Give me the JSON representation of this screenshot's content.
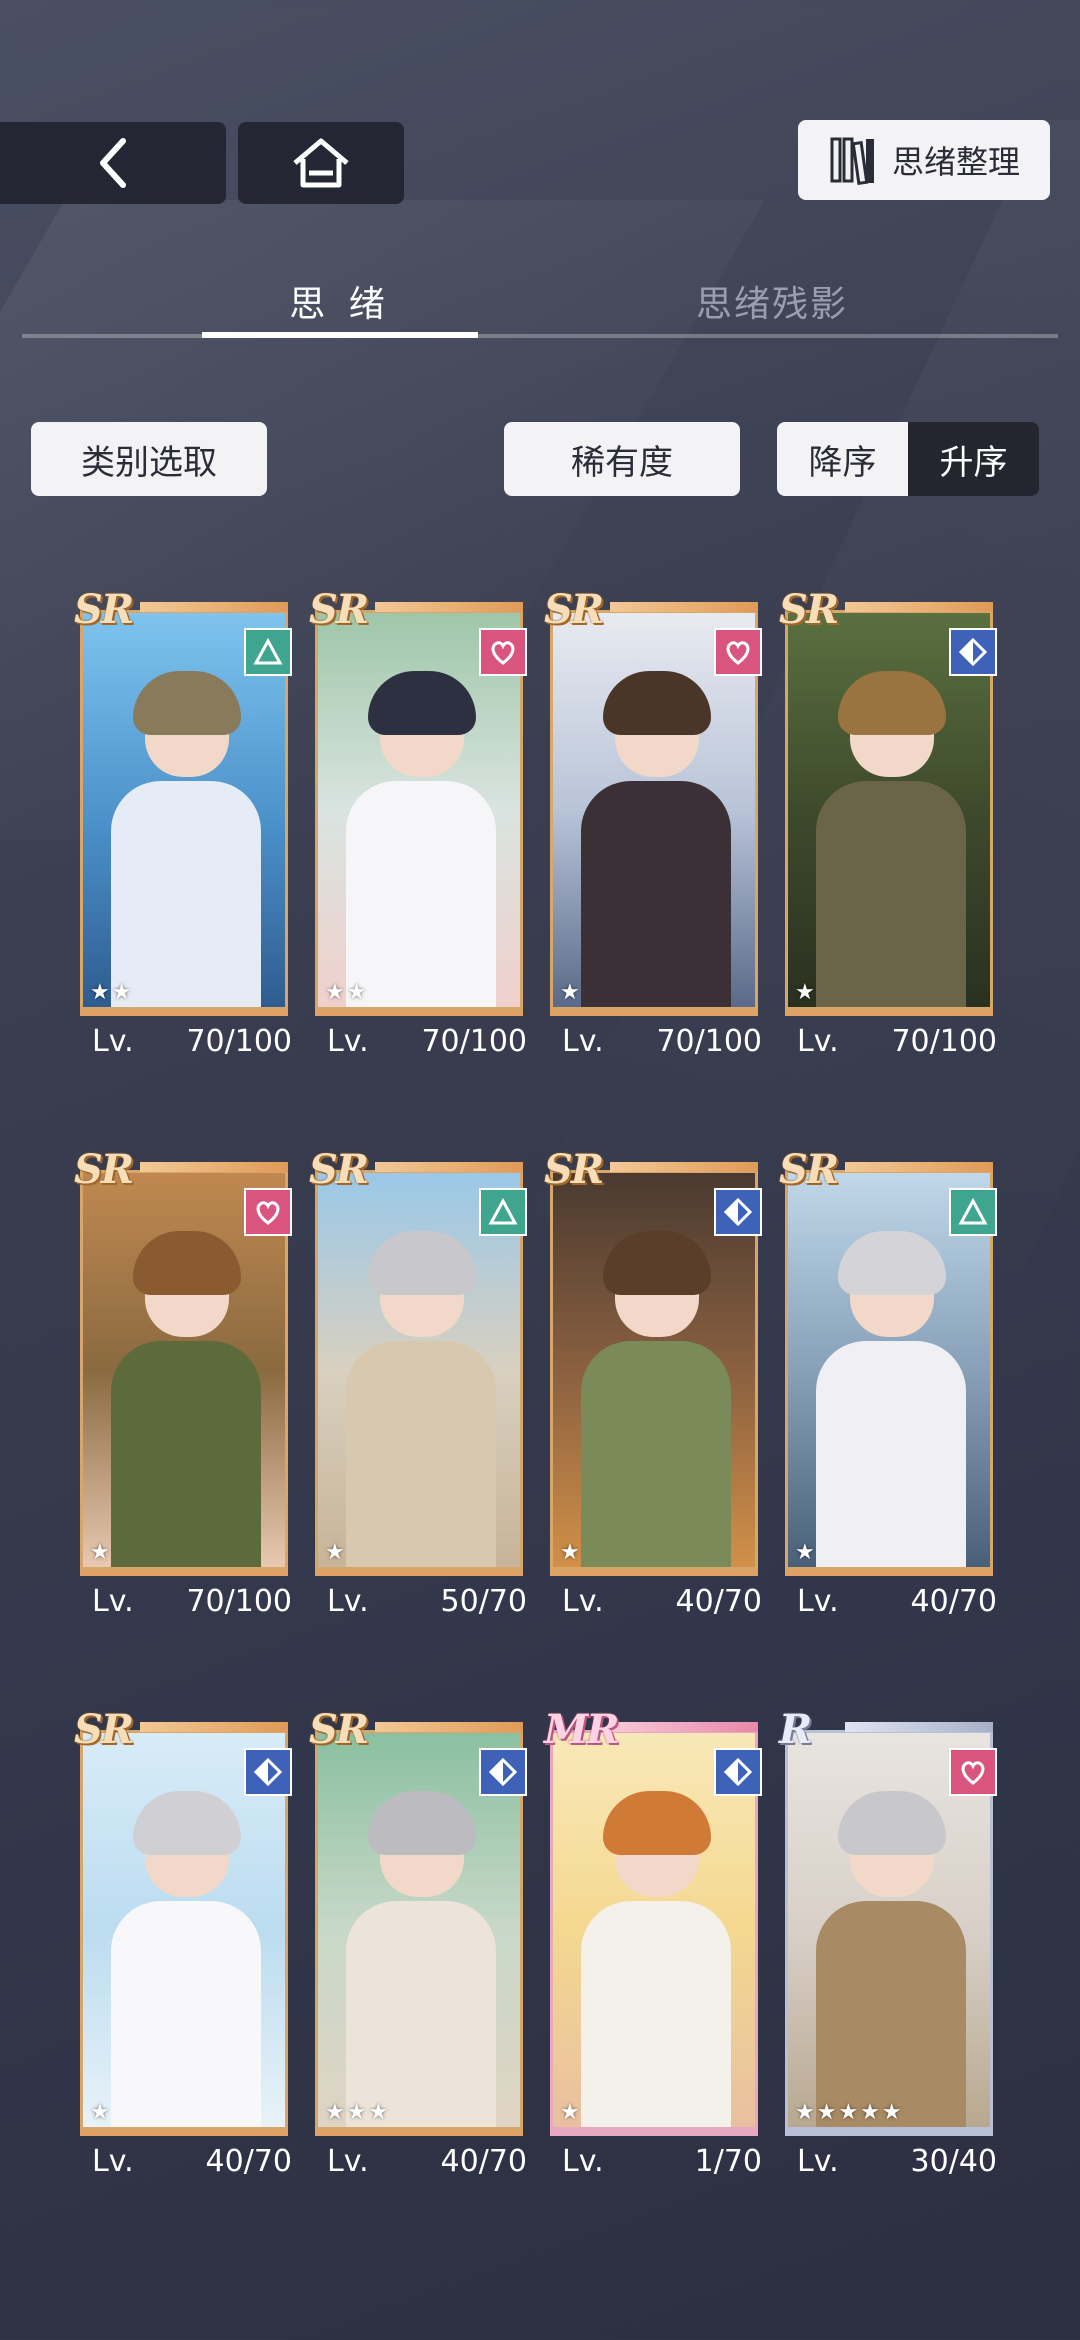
{
  "header": {
    "organize_label": "思绪整理"
  },
  "tabs": [
    {
      "label": "思 绪",
      "active": true
    },
    {
      "label": "思绪残影",
      "active": false
    }
  ],
  "filters": {
    "category_label": "类别选取",
    "rarity_label": "稀有度",
    "sort_desc_label": "降序",
    "sort_asc_label": "升序",
    "sort_selected": "升序"
  },
  "colors": {
    "attr_green": "#3fa58e",
    "attr_pink": "#d9547e",
    "attr_blue": "#3d62b8",
    "sr_frame": "#d9a66a",
    "mr_frame": "#e8a8c0",
    "r_frame": "#b8c0d8"
  },
  "cards": [
    {
      "rarity": "SR",
      "attribute": "triangle-icon",
      "stars": "★★",
      "lv_label": "Lv.",
      "level": "70/100"
    },
    {
      "rarity": "SR",
      "attribute": "heart-icon",
      "stars": "★★",
      "lv_label": "Lv.",
      "level": "70/100"
    },
    {
      "rarity": "SR",
      "attribute": "heart-icon",
      "stars": "★",
      "lv_label": "Lv.",
      "level": "70/100"
    },
    {
      "rarity": "SR",
      "attribute": "diamond-icon",
      "stars": "★",
      "lv_label": "Lv.",
      "level": "70/100"
    },
    {
      "rarity": "SR",
      "attribute": "heart-icon",
      "stars": "★",
      "lv_label": "Lv.",
      "level": "70/100"
    },
    {
      "rarity": "SR",
      "attribute": "triangle-icon",
      "stars": "★",
      "lv_label": "Lv.",
      "level": "50/70"
    },
    {
      "rarity": "SR",
      "attribute": "diamond-icon",
      "stars": "★",
      "lv_label": "Lv.",
      "level": "40/70"
    },
    {
      "rarity": "SR",
      "attribute": "triangle-icon",
      "stars": "★",
      "lv_label": "Lv.",
      "level": "40/70"
    },
    {
      "rarity": "SR",
      "attribute": "diamond-icon",
      "stars": "★",
      "lv_label": "Lv.",
      "level": "40/70"
    },
    {
      "rarity": "SR",
      "attribute": "diamond-icon",
      "stars": "★★★",
      "lv_label": "Lv.",
      "level": "40/70"
    },
    {
      "rarity": "MR",
      "attribute": "diamond-icon",
      "stars": "★",
      "lv_label": "Lv.",
      "level": "1/70"
    },
    {
      "rarity": "R",
      "attribute": "heart-icon",
      "stars": "★★★★★",
      "lv_label": "Lv.",
      "level": "30/40"
    }
  ]
}
